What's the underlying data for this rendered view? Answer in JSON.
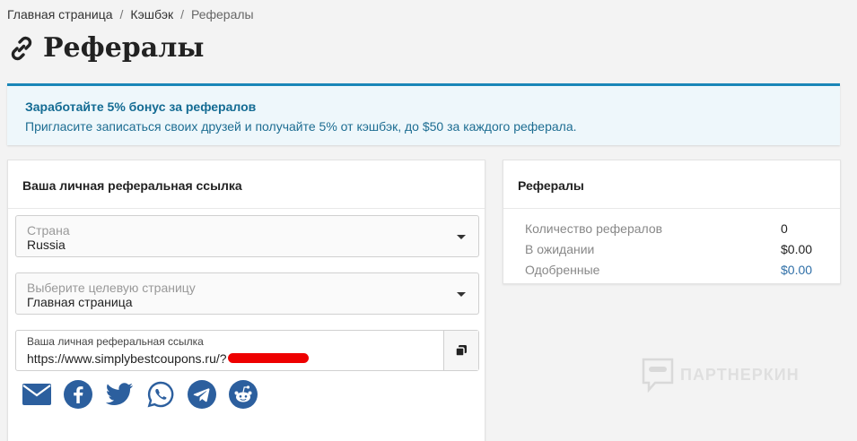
{
  "breadcrumb": {
    "items": [
      "Главная страница",
      "Кэшбэк",
      "Рефералы"
    ],
    "separator": "/"
  },
  "page": {
    "title": "Рефералы",
    "icon": "link-icon"
  },
  "alert": {
    "title": "Заработайте 5% бонус за рефералов",
    "text": "Пригласите записаться своих друзей и получайте 5% от кэшбэк, до $50 за каждого реферала.",
    "accent": "#1a86b8"
  },
  "referral_card": {
    "header": "Ваша личная реферальная ссылка",
    "country_select": {
      "label": "Страна",
      "value": "Russia"
    },
    "page_select": {
      "label": "Выберите целевую страницу",
      "value": "Главная страница"
    },
    "link_field": {
      "label": "Ваша личная реферальная ссылка",
      "value": "https://www.simplybestcoupons.ru/?"
    },
    "social": [
      "email-icon",
      "facebook-icon",
      "twitter-icon",
      "whatsapp-icon",
      "telegram-icon",
      "reddit-icon"
    ],
    "social_color": "#2c5f9e"
  },
  "stats_card": {
    "header": "Рефералы",
    "rows": [
      {
        "label": "Количество рефералов",
        "value": "0"
      },
      {
        "label": "В ожидании",
        "value": "$0.00"
      },
      {
        "label": "Одобренные",
        "value": "$0.00"
      }
    ]
  },
  "watermark": {
    "text": "ПАРТНЕРКИН"
  }
}
